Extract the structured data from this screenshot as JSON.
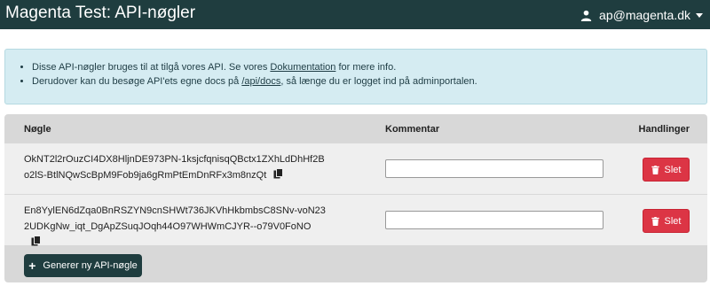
{
  "header": {
    "title": "Magenta Test: API-nøgler",
    "user_email": "ap@magenta.dk",
    "user_icon": "user-icon",
    "dropdown_icon": "caret-down-icon"
  },
  "info": {
    "line1_pre": "Disse API-nøgler bruges til at tilgå vores API. Se vores ",
    "line1_link": "Dokumentation",
    "line1_post": " for mere info.",
    "line2_pre": "Derudover kan du besøge API'ets egne docs på ",
    "line2_link": "/api/docs",
    "line2_post": ", så længe du er logget ind på adminportalen."
  },
  "table": {
    "headers": {
      "key": "Nøgle",
      "comment": "Kommentar",
      "actions": "Handlinger"
    },
    "rows": [
      {
        "key": "OkNT2l2rOuzCI4DX8HljnDE973PN-1ksjcfqnisqQBctx1ZXhLdDhHf2Bo2lS-BtlNQwScBpM9Fob9ja6gRmPtEmDnRFx3m8nzQt",
        "comment": "",
        "delete_label": "Slet"
      },
      {
        "key": "En8YylEN6dZqa0BnRSZYN9cnSHWt736JKVhHkbmbsC8SNv-voN232UDKgNw_iqt_DgApZSuqJOqh44O97WHWmCJYR--o79V0FoNO",
        "comment": "",
        "delete_label": "Slet"
      }
    ]
  },
  "generate_button": {
    "label": "Generer ny API-nøgle"
  },
  "colors": {
    "topbar": "#1f3d3f",
    "info_bg": "#d5ecf2",
    "danger": "#dc3545"
  }
}
